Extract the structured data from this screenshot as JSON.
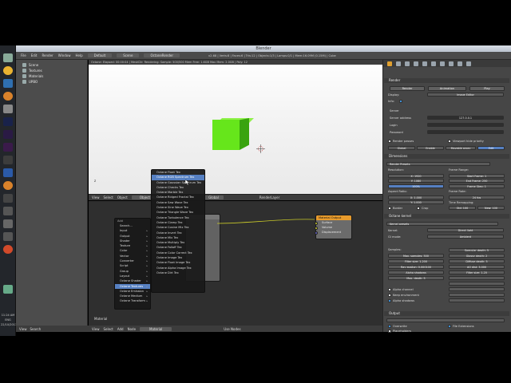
{
  "window": {
    "title": "Blender",
    "menus": [
      "File",
      "Edit",
      "Render",
      "Window",
      "Help"
    ],
    "layout": "Default",
    "scene": "Scene",
    "engine": "OctaneRender",
    "info": "v2.68 | Verts:8 | Faces:6 | Tris:12 | Objects:1/3 | Lamps:0/1 | Mem:16.09M (0.15M) | Cube"
  },
  "outliner": {
    "items": [
      "Scene",
      "Textures",
      "Materials",
      "UPBO"
    ]
  },
  "viewport": {
    "header": "Octane: Elapsed: 00:00:04 | MeshDir: Rendering: Sample: 500/500 Mem Free: 1.6GB Max Mem: 2.0GB | Poly: 12",
    "toolbar": [
      "View",
      "Select",
      "Object",
      "Object Mode",
      "Global",
      "RenderLayer"
    ],
    "axis": "z"
  },
  "node_editor": {
    "toolbar": [
      "View",
      "Select",
      "Add",
      "Node",
      "Use Nodes"
    ],
    "material_name": "Material",
    "timeline_label": "Material",
    "material_node": {
      "title": "Material Output",
      "sockets": [
        "Surface",
        "Volume",
        "Displacement"
      ]
    },
    "partial_node": {
      "title": "",
      "sockets": []
    }
  },
  "add_menu": {
    "title": "Add",
    "items": [
      "Search...",
      "Input",
      "Output",
      "Shader",
      "Texture",
      "Color",
      "Vector",
      "Converter",
      "Script",
      "Group",
      "Layout",
      "Octane Shader",
      "Octane Textures",
      "Octane Emission",
      "Octane Medium",
      "Octane Transform"
    ],
    "highlighted_index": 12
  },
  "tex_menu": {
    "items": [
      "Octane Float Tex",
      "Octane RGB Spectrum Tex",
      "Octane Gaussian Spectrum Tex",
      "Octane Checks Tex",
      "Octane Marble Tex",
      "Octane Ridged Fractal Tex",
      "Octane Saw Wave Tex",
      "Octane Sine Wave Tex",
      "Octane Triangle Wave Tex",
      "Octane Turbulence Tex",
      "Octane Clamp Tex",
      "Octane Cosine Mix Tex",
      "Octane Invert Tex",
      "Octane Mix Tex",
      "Octane Multiply Tex",
      "Octane Falloff Tex",
      "Octane Color Correct Tex",
      "Octane Image Tex",
      "Octane Float Image Tex",
      "Octane Alpha Image Tex",
      "Octane Dirt Tex"
    ],
    "highlighted_index": 1
  },
  "bottom_strip": [
    "View",
    "Search"
  ],
  "properties": {
    "sections": {
      "render": "Render",
      "dimensions": "Dimensions",
      "kernel": "Octane kernel",
      "output": "Output"
    },
    "render_buttons": [
      "Render",
      "Animation",
      "Play"
    ],
    "display_label": "Display:",
    "display_value": "Image Editor",
    "info_label": "Info:",
    "server_label": "Server",
    "server_address_label": "Server address",
    "server_address_value": "127.0.0.1",
    "login_label": "Login",
    "password_label": "Password",
    "render_passes_label": "Render passes",
    "viewport_hide_priority_label": "Viewport hide priority",
    "passes_buttons": [
      "Global",
      "Enable",
      "Movable proxy",
      "Edit"
    ],
    "render_presets_label": "Render Presets",
    "resolution_label": "Resolution:",
    "res_x": "X: 1920",
    "res_y": "Y: 1080",
    "res_pct": "100%",
    "aspect_label": "Aspect Ratio:",
    "aspect_x": "X: 1.000",
    "aspect_y": "Y: 1.000",
    "border_label": "Border",
    "crop_label": "Crop",
    "frame_range_label": "Frame Range:",
    "start_frame": "Start Frame: 1",
    "end_frame": "End Frame: 250",
    "frame_step": "Frame Step: 1",
    "frame_rate_label": "Frame Rate:",
    "frame_rate": "24 fps",
    "time_remap_label": "Time Remapping:",
    "time_old": "Old: 100",
    "time_new": "New: 100",
    "kernel_label": "Kernel presets",
    "kernel_row_label": "Kernel:",
    "kernel_value": "Direct light",
    "gi_mode_label": "GI mode:",
    "gi_mode_value": "Ambient",
    "samples_label": "Samples:",
    "samples": [
      "Max. samples: 500",
      "Filter size: 1.200",
      "Ray epsilon: 0.000100",
      "Alpha shadows",
      "Max. depth: 5"
    ],
    "specular_col": [
      "Specular depth: 5",
      "Glossy depth: 2",
      "Diffuse depth: 5",
      "AO dist: 3.000",
      "Filter size: 1.20"
    ],
    "alpha_channel_label": "Alpha channel",
    "keep_env_label": "Keep environment",
    "alpha_shadows_label": "Alpha shadows",
    "file_extensions_label": "File Extensions",
    "overwrite_label": "Overwrite",
    "placeholders_label": "Placeholders"
  },
  "taskbar": {
    "time": "11:24 AM",
    "lang": "ENG",
    "date": "22/10/2013"
  },
  "colors": {
    "cube": "#66e61b",
    "highlight": "#5680c2",
    "node_output_header": "#e89b2c",
    "socket": "#c7c729"
  }
}
